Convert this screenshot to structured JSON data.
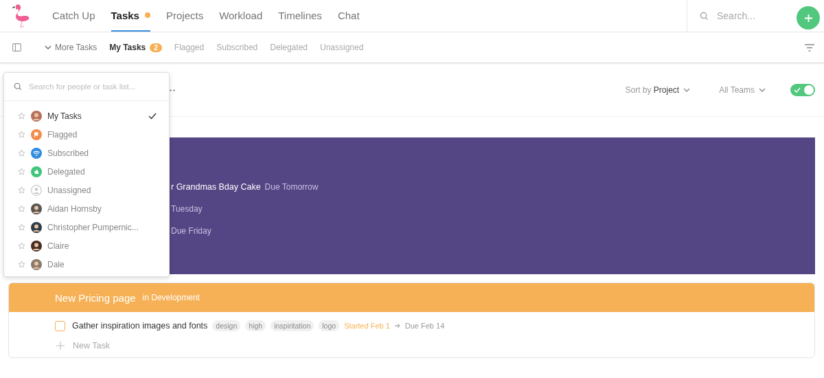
{
  "nav": {
    "tabs": [
      {
        "label": "Catch Up",
        "selected": false,
        "dot": false
      },
      {
        "label": "Tasks",
        "selected": true,
        "dot": true
      },
      {
        "label": "Projects",
        "selected": false,
        "dot": false
      },
      {
        "label": "Workload",
        "selected": false,
        "dot": false
      },
      {
        "label": "Timelines",
        "selected": false,
        "dot": false
      },
      {
        "label": "Chat",
        "selected": false,
        "dot": false
      }
    ],
    "search": {
      "placeholder": "Search..."
    }
  },
  "subnav": {
    "more": "More Tasks",
    "tabs": [
      {
        "label": "My Tasks",
        "selected": true,
        "badge": "2"
      },
      {
        "label": "Flagged",
        "selected": false
      },
      {
        "label": "Subscribed",
        "selected": false
      },
      {
        "label": "Delegated",
        "selected": false
      },
      {
        "label": "Unassigned",
        "selected": false
      }
    ]
  },
  "toolbar": {
    "sort_label": "Sort by",
    "sort_value": "Project",
    "teams": "All Teams",
    "toggle_on": true
  },
  "dropdown": {
    "placeholder": "Search for people or task list...",
    "items": [
      {
        "label": "My Tasks",
        "kind": "avatar",
        "color": "#b7705a",
        "selected": true
      },
      {
        "label": "Flagged",
        "kind": "flag",
        "color": "#f28c4a",
        "selected": false
      },
      {
        "label": "Subscribed",
        "kind": "wifi",
        "color": "#2f8be0",
        "selected": false
      },
      {
        "label": "Delegated",
        "kind": "hand",
        "color": "#3fc67a",
        "selected": false
      },
      {
        "label": "Unassigned",
        "kind": "person",
        "color": "#c8c8c8",
        "selected": false
      },
      {
        "label": "Aidan Hornsby",
        "kind": "avatar",
        "color": "#5a5550",
        "selected": false
      },
      {
        "label": "Christopher Pumpernic...",
        "kind": "avatar",
        "color": "#2f3c48",
        "selected": false
      },
      {
        "label": "Claire",
        "kind": "avatar",
        "color": "#4a2e22",
        "selected": false
      },
      {
        "label": "Dale",
        "kind": "avatar",
        "color": "#8a7a6a",
        "selected": false
      }
    ]
  },
  "projects": [
    {
      "color": "#544584",
      "tasks": [
        {
          "title": "r Grandmas Bday Cake",
          "due": "Due Tomorrow"
        },
        {
          "due": "Tuesday"
        },
        {
          "due": "Due Friday"
        }
      ]
    },
    {
      "color": "#f6b156",
      "title": "New Pricing page",
      "status": "in Development",
      "tasks": [
        {
          "title": "Gather inspiration images and fonts",
          "checked": false,
          "tags": [
            "design",
            "high",
            "inspiritation",
            "logo"
          ],
          "started": "Started Feb 1",
          "due": "Due Feb 14"
        }
      ],
      "new_task": "New Task"
    }
  ]
}
